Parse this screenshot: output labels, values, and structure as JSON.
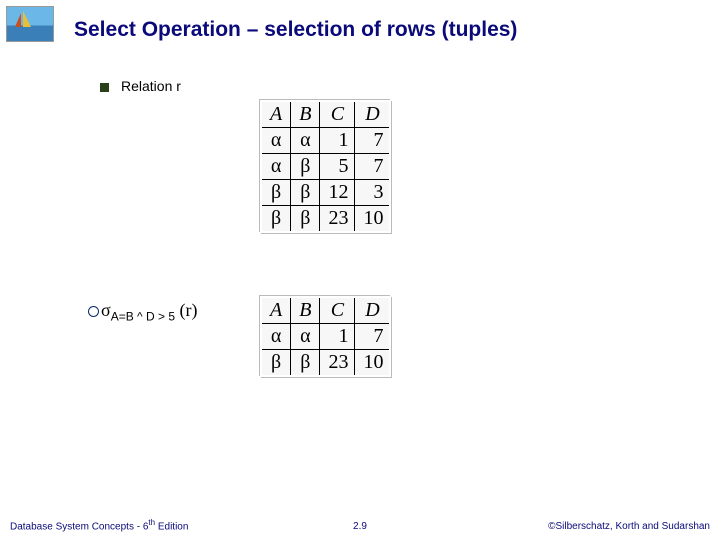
{
  "title": "Select Operation – selection of rows (tuples)",
  "bullet_label": "Relation r",
  "selection_expr": {
    "sigma": "σ",
    "sub": "A=B ^ D > 5",
    "arg": "(r)"
  },
  "table1": {
    "headers": [
      "A",
      "B",
      "C",
      "D"
    ],
    "rows": [
      [
        "α",
        "α",
        "1",
        "7"
      ],
      [
        "α",
        "β",
        "5",
        "7"
      ],
      [
        "β",
        "β",
        "12",
        "3"
      ],
      [
        "β",
        "β",
        "23",
        "10"
      ]
    ]
  },
  "table2": {
    "headers": [
      "A",
      "B",
      "C",
      "D"
    ],
    "rows": [
      [
        "α",
        "α",
        "1",
        "7"
      ],
      [
        "β",
        "β",
        "23",
        "10"
      ]
    ]
  },
  "footer": {
    "left_pre": "Database System Concepts - 6",
    "left_sup": "th",
    "left_post": " Edition",
    "center": "2.9",
    "right": "©Silberschatz, Korth and Sudarshan"
  }
}
